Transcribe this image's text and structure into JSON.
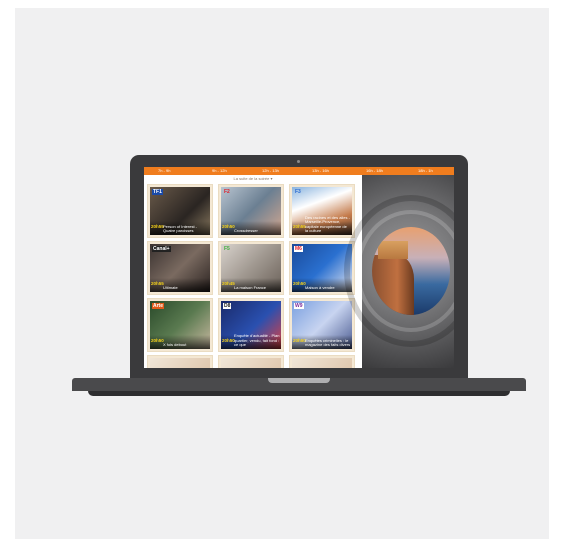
{
  "timebar": {
    "slots": [
      "7h - 9h",
      "9h - 12h",
      "12h - 13h",
      "13h - 16h",
      "16h - 18h",
      "18h - 1h"
    ]
  },
  "subtitle": "La suite de la soirée",
  "programs": [
    {
      "time": "20h55",
      "title": "Person of Interest - Quatre paroisses",
      "channel": "TF1"
    },
    {
      "time": "20h50",
      "title": "Crossdresser",
      "channel": "F2"
    },
    {
      "time": "20h55",
      "title": "Des racines et des ailes - Marseille-Provence, capitale européenne de la culture",
      "channel": "F3"
    },
    {
      "time": "20h55",
      "title": "Ultimate",
      "channel": "Canal+"
    },
    {
      "time": "20h45",
      "title": "La maison France",
      "channel": "F5"
    },
    {
      "time": "20h50",
      "title": "Maison à vendre",
      "channel": "M6"
    },
    {
      "time": "20h50",
      "title": "X fois debout",
      "channel": "Arte"
    },
    {
      "time": "20h50",
      "title": "Enquête d'actualité - Plan quartier, vendu, fait fond : ce que",
      "channel": "D8"
    },
    {
      "time": "20h50",
      "title": "Enquêtes criminelles : le magazine des faits divers",
      "channel": "W9"
    },
    {
      "time": "",
      "title": "",
      "channel": ""
    },
    {
      "time": "",
      "title": "",
      "channel": ""
    },
    {
      "time": "",
      "title": "",
      "channel": ""
    }
  ],
  "colors": {
    "accent": "#f07d1e",
    "time_text": "#f5d21a"
  }
}
